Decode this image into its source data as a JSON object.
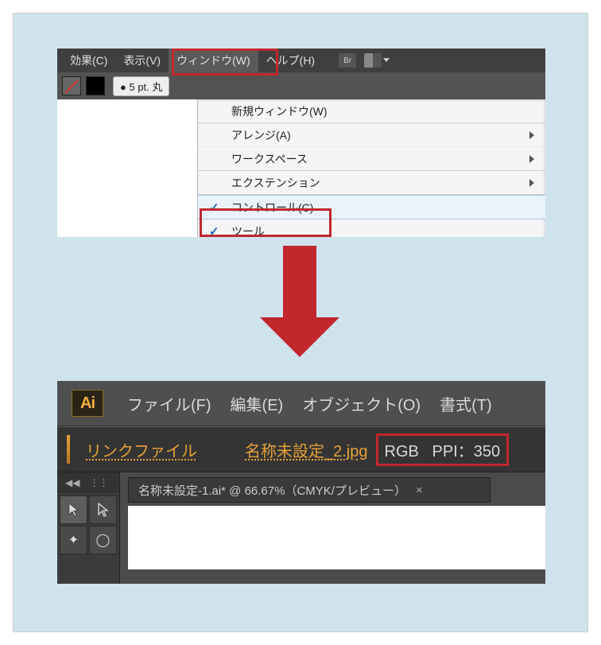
{
  "top": {
    "menubar": {
      "effect": "効果(C)",
      "view": "表示(V)",
      "window": "ウィンドウ(W)",
      "help": "ヘルプ(H)",
      "badge": "Br"
    },
    "toolbar": {
      "stroke_weight": "● 5 pt. 丸"
    },
    "dropdown": {
      "new_window": "新規ウィンドウ(W)",
      "arrange": "アレンジ(A)",
      "workspace": "ワークスペース",
      "extension": "エクステンション",
      "control": "コントロール(C)",
      "tool": "ツール"
    }
  },
  "bottom": {
    "logo": "Ai",
    "menu": {
      "file": "ファイル(F)",
      "edit": "編集(E)",
      "object": "オブジェクト(O)",
      "type": "書式(T)"
    },
    "controlbar": {
      "link_file": "リンクファイル",
      "filename": "名称未設定_2.jpg",
      "colormode": "RGB",
      "ppi": "PPI：350"
    },
    "tabs": {
      "active": "名称未設定-1.ai* @ 66.67%（CMYK/プレビュー）",
      "close": "×"
    },
    "toolnav": {
      "back": "◀◀",
      "dots": "⋮⋮"
    }
  }
}
